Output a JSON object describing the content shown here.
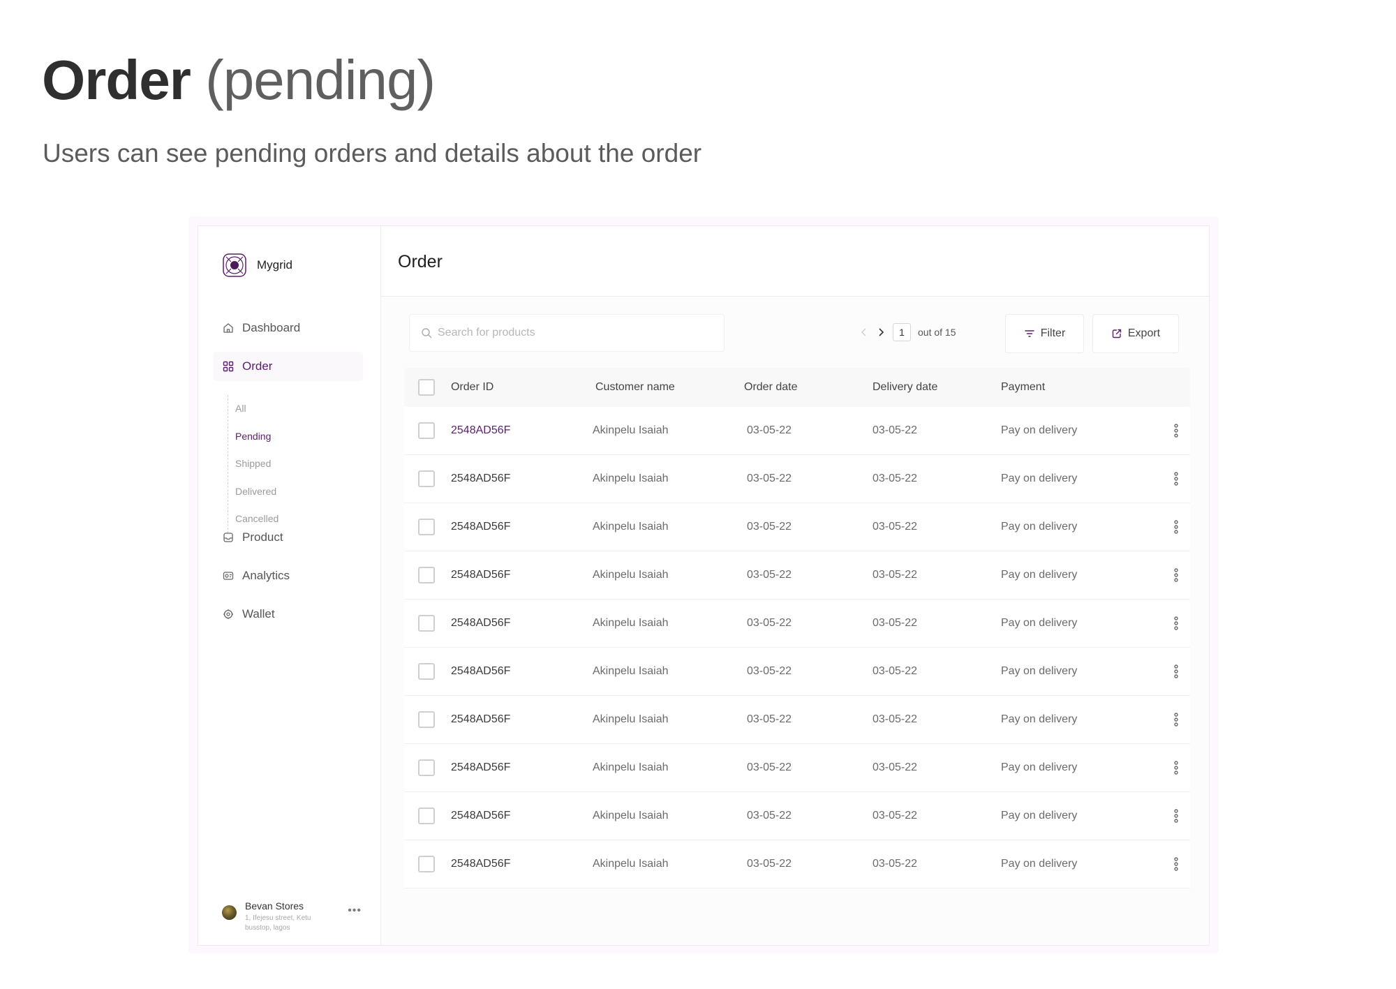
{
  "hero": {
    "title_main": "Order",
    "title_suffix": "(pending)",
    "subtitle": "Users can see pending orders and details about the order"
  },
  "brand": {
    "name": "Mygrid",
    "accent": "#5b1e6c"
  },
  "sidebar": {
    "items": [
      {
        "label": "Dashboard",
        "icon": "home-icon"
      },
      {
        "label": "Order",
        "icon": "grid-icon",
        "active": true
      },
      {
        "label": "Product",
        "icon": "inbox-icon"
      },
      {
        "label": "Analytics",
        "icon": "analytics-icon"
      },
      {
        "label": "Wallet",
        "icon": "wallet-icon"
      }
    ],
    "order_sub": [
      "All",
      "Pending",
      "Shipped",
      "Delivered",
      "Cancelled"
    ],
    "order_sub_active": "Pending"
  },
  "profile": {
    "name": "Bevan Stores",
    "address": "1, Ifejesu street, Ketu busstop, lagos"
  },
  "main": {
    "title": "Order"
  },
  "toolbar": {
    "search_placeholder": "Search for products",
    "page": "1",
    "page_total": "out of 15",
    "filter_label": "Filter",
    "export_label": "Export"
  },
  "table": {
    "columns": [
      "Order ID",
      "Customer name",
      "Order date",
      "Delivery date",
      "Payment"
    ],
    "rows": [
      {
        "id": "2548AD56F",
        "customer": "Akinpelu Isaiah",
        "order_date": "03-05-22",
        "delivery_date": "03-05-22",
        "payment": "Pay on delivery"
      },
      {
        "id": "2548AD56F",
        "customer": "Akinpelu Isaiah",
        "order_date": "03-05-22",
        "delivery_date": "03-05-22",
        "payment": "Pay on delivery"
      },
      {
        "id": "2548AD56F",
        "customer": "Akinpelu Isaiah",
        "order_date": "03-05-22",
        "delivery_date": "03-05-22",
        "payment": "Pay on delivery"
      },
      {
        "id": "2548AD56F",
        "customer": "Akinpelu Isaiah",
        "order_date": "03-05-22",
        "delivery_date": "03-05-22",
        "payment": "Pay on delivery"
      },
      {
        "id": "2548AD56F",
        "customer": "Akinpelu Isaiah",
        "order_date": "03-05-22",
        "delivery_date": "03-05-22",
        "payment": "Pay on delivery"
      },
      {
        "id": "2548AD56F",
        "customer": "Akinpelu Isaiah",
        "order_date": "03-05-22",
        "delivery_date": "03-05-22",
        "payment": "Pay on delivery"
      },
      {
        "id": "2548AD56F",
        "customer": "Akinpelu Isaiah",
        "order_date": "03-05-22",
        "delivery_date": "03-05-22",
        "payment": "Pay on delivery"
      },
      {
        "id": "2548AD56F",
        "customer": "Akinpelu Isaiah",
        "order_date": "03-05-22",
        "delivery_date": "03-05-22",
        "payment": "Pay on delivery"
      },
      {
        "id": "2548AD56F",
        "customer": "Akinpelu Isaiah",
        "order_date": "03-05-22",
        "delivery_date": "03-05-22",
        "payment": "Pay on delivery"
      },
      {
        "id": "2548AD56F",
        "customer": "Akinpelu Isaiah",
        "order_date": "03-05-22",
        "delivery_date": "03-05-22",
        "payment": "Pay on delivery"
      }
    ]
  }
}
